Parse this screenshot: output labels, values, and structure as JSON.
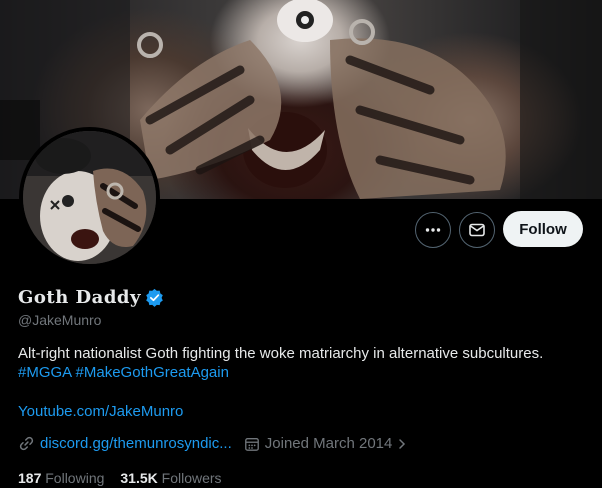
{
  "profile": {
    "display_name": "Goth Daddy",
    "verified": true,
    "handle": "@JakeMunro",
    "bio_line1": "Alt-right nationalist Goth fighting the woke matriarchy in alternative subcultures.",
    "hashtag1": "#MGGA",
    "hashtag2": "#MakeGothGreatAgain",
    "website": "Youtube.com/JakeMunro",
    "discord_link": "discord.gg/themunrosyndic...",
    "joined": "Joined March 2014",
    "following_count": "187",
    "following_label": "Following",
    "followers_count": "31.5K",
    "followers_label": "Followers"
  },
  "actions": {
    "follow_label": "Follow",
    "more_icon": "more-dots-icon",
    "mail_icon": "envelope-icon"
  },
  "colors": {
    "accent": "#1d9bf0",
    "background": "#000000",
    "follow_button_bg": "#eff3f4",
    "muted_text": "#71767b"
  }
}
